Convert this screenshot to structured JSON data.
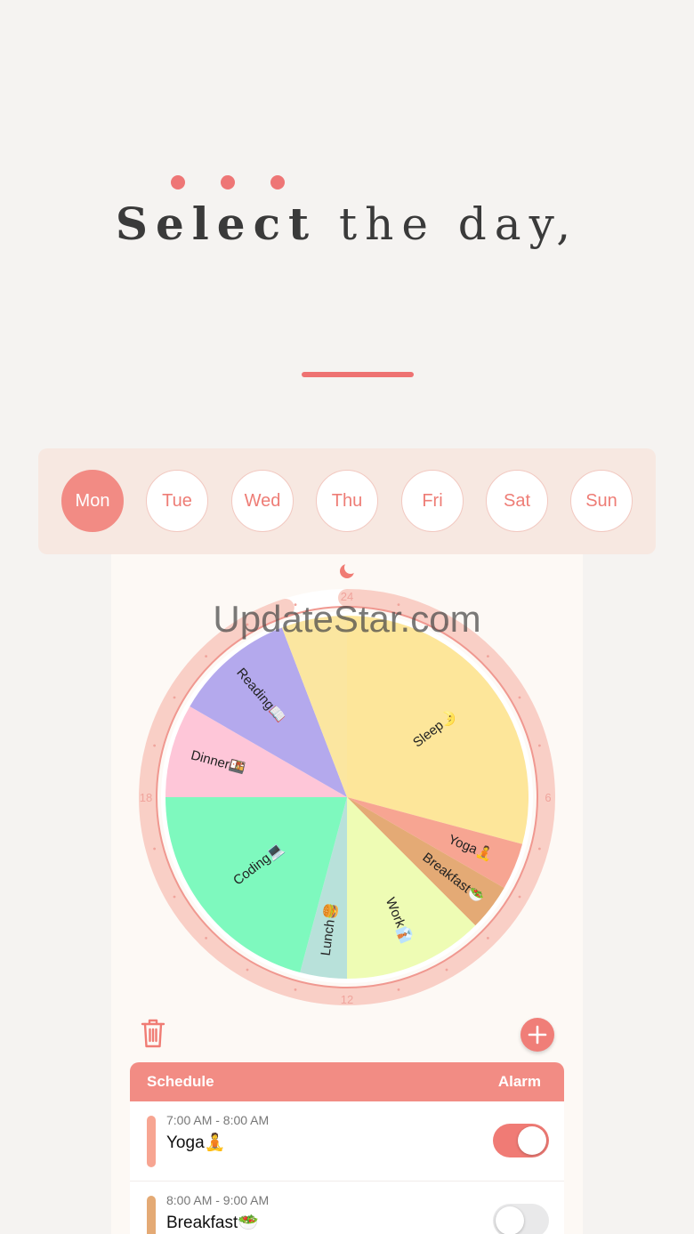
{
  "headline": {
    "bold": "Select",
    "rest": " the day,"
  },
  "days": [
    {
      "label": "Mon",
      "active": true
    },
    {
      "label": "Tue",
      "active": false
    },
    {
      "label": "Wed",
      "active": false
    },
    {
      "label": "Thu",
      "active": false
    },
    {
      "label": "Fri",
      "active": false
    },
    {
      "label": "Sat",
      "active": false
    },
    {
      "label": "Sun",
      "active": false
    }
  ],
  "watermark": "UpdateStar.com",
  "clock": {
    "top_label": "24",
    "right_label": "6",
    "bottom_label": "12",
    "left_label": "18",
    "top_icon": "moon-icon",
    "bottom_icon": "sun-icon"
  },
  "wheel_segments": [
    {
      "name": "Sleep🌛",
      "start": 0,
      "end": 7,
      "color": "#fde69a"
    },
    {
      "name": "Yoga🧘",
      "start": 7,
      "end": 8,
      "color": "#f7a592"
    },
    {
      "name": "Breakfast🥗",
      "start": 8,
      "end": 9,
      "color": "#e4aa75"
    },
    {
      "name": "Work👔",
      "start": 9,
      "end": 12,
      "color": "#eefcb4"
    },
    {
      "name": "Lunch🍔",
      "start": 12,
      "end": 13,
      "color": "#b8e1da"
    },
    {
      "name": "Coding💻",
      "start": 13,
      "end": 18,
      "color": "#7ef9be"
    },
    {
      "name": "Dinner🍱",
      "start": 18,
      "end": 20,
      "color": "#fec6d8"
    },
    {
      "name": "Reading📖",
      "start": 20,
      "end": 22.6,
      "color": "#b4a9ed"
    }
  ],
  "progress_ring": {
    "fraction": 0.95
  },
  "toolbar": {
    "delete_icon": "trash-icon",
    "add_icon": "plus-icon"
  },
  "schedule": {
    "header_left": "Schedule",
    "header_right": "Alarm",
    "items": [
      {
        "time": "7:00 AM - 8:00 AM",
        "title": "Yoga🧘",
        "color": "#f7a592",
        "alarm_on": true
      },
      {
        "time": "8:00 AM - 9:00 AM",
        "title": "Breakfast🥗",
        "color": "#e4aa75",
        "alarm_on": false
      }
    ]
  },
  "colors": {
    "accent": "#ee7676",
    "ring": "#f28c84"
  }
}
